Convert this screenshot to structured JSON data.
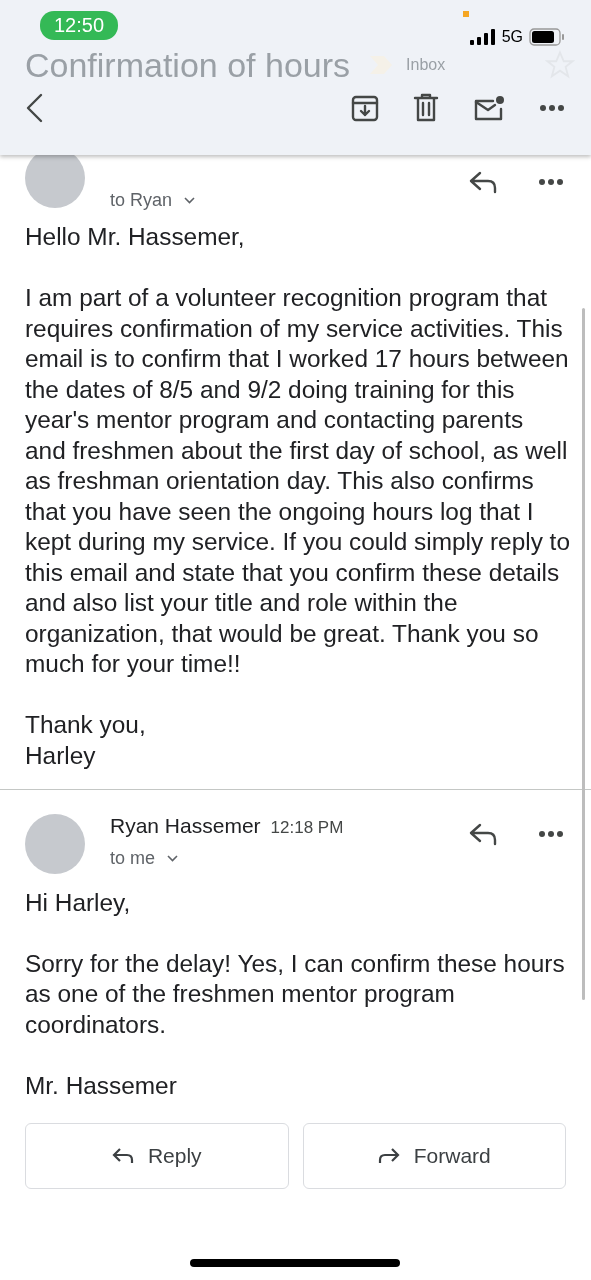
{
  "status_bar": {
    "time": "12:50",
    "network": "5G"
  },
  "header": {
    "subject": "Confirmation of hours",
    "label": "Inbox"
  },
  "messages": [
    {
      "recipient": "to Ryan",
      "paragraphs": [
        "Hello Mr. Hassemer,",
        "I am part of a volunteer recognition program that requires confirmation of my service activities. This email is to confirm that I worked 17 hours between the dates of 8/5 and 9/2 doing training for this year's mentor program and contacting parents and freshmen about the first day of school, as well as freshman orientation day. This also confirms that you have seen the ongoing hours log that I kept during my service. If you could simply reply to this email and state that you confirm these details and also list your title and role within the organization, that would be great. Thank you so much for your time!!",
        "Thank you,\nHarley"
      ]
    },
    {
      "sender": "Ryan Hassemer",
      "time": "12:18 PM",
      "recipient": "to me",
      "paragraphs": [
        "Hi Harley,",
        "Sorry for the delay! Yes, I can confirm these hours as one of the freshmen mentor program coordinators.",
        "Mr. Hassemer"
      ]
    }
  ],
  "actions": [
    {
      "kind": "reply",
      "label": "Reply"
    },
    {
      "kind": "forward",
      "label": "Forward"
    }
  ]
}
